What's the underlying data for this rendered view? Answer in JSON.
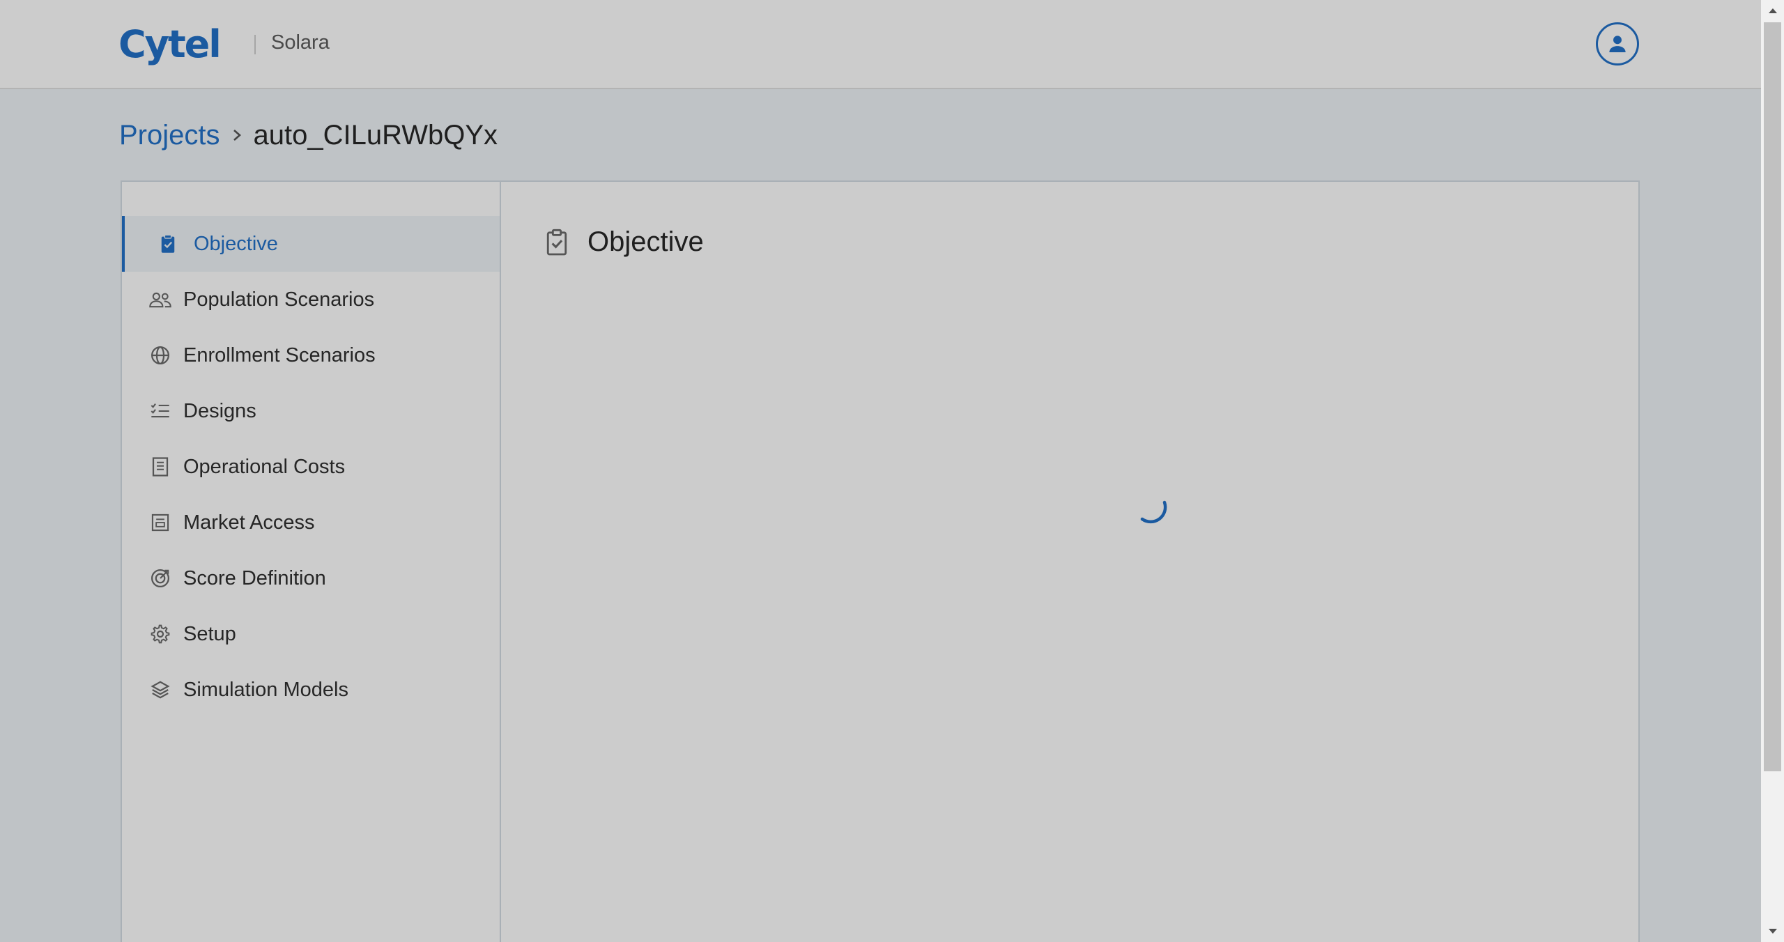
{
  "header": {
    "logo_text": "Cytel",
    "app_name": "Solara",
    "avatar_icon": "user-circle-icon"
  },
  "breadcrumb": {
    "root": "Projects",
    "separator_icon": "chevron-right-icon",
    "current": "auto_CILuRWbQYx"
  },
  "sidebar": {
    "items": [
      {
        "label": "Objective",
        "icon": "clipboard-check-icon",
        "active": true
      },
      {
        "label": "Population Scenarios",
        "icon": "users-icon",
        "active": false
      },
      {
        "label": "Enrollment Scenarios",
        "icon": "globe-icon",
        "active": false
      },
      {
        "label": "Designs",
        "icon": "list-check-icon",
        "active": false
      },
      {
        "label": "Operational Costs",
        "icon": "receipt-icon",
        "active": false
      },
      {
        "label": "Market Access",
        "icon": "document-icon",
        "active": false
      },
      {
        "label": "Score Definition",
        "icon": "target-icon",
        "active": false
      },
      {
        "label": "Setup",
        "icon": "gear-icon",
        "active": false
      },
      {
        "label": "Simulation Models",
        "icon": "layers-icon",
        "active": false
      }
    ]
  },
  "content": {
    "title": "Objective",
    "title_icon": "clipboard-check-icon",
    "loading_icon": "spinner-icon"
  },
  "colors": {
    "accent": "#1b5aa0",
    "background": "#bfc3c6",
    "surface": "#cccccc",
    "border": "#a9b0b6"
  }
}
